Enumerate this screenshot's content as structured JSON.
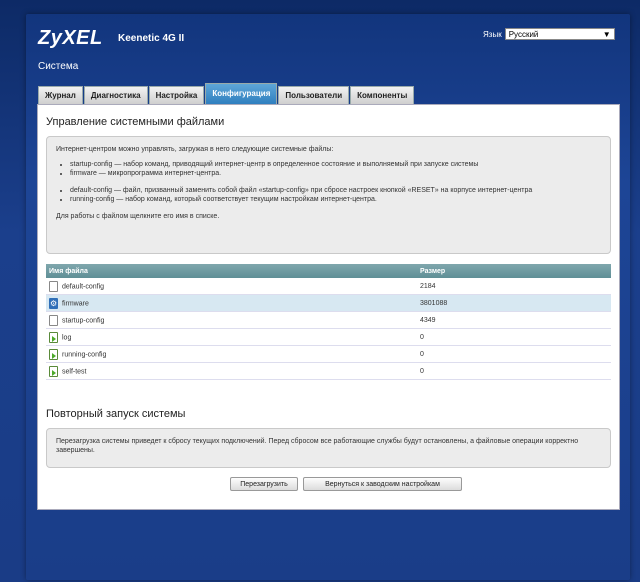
{
  "header": {
    "logo": "ZyXEL",
    "model": "Keenetic 4G II",
    "section": "Система",
    "language_label": "Язык",
    "language_value": "Русский"
  },
  "tabs": [
    {
      "label": "Журнал",
      "active": false
    },
    {
      "label": "Диагностика",
      "active": false
    },
    {
      "label": "Настройка",
      "active": false
    },
    {
      "label": "Конфигурация",
      "active": true
    },
    {
      "label": "Пользователи",
      "active": false
    },
    {
      "label": "Компоненты",
      "active": false
    }
  ],
  "files_section": {
    "title": "Управление системными файлами",
    "intro": "Интернет-центром можно управлять, загружая в него следующие системные файлы:",
    "bullets1": [
      "startup-config — набор команд, приводящий интернет-центр в определенное состояние и выполняемый при запуске системы",
      "firmware — микропрограмма интернет-центра."
    ],
    "bullets2": [
      "default-config — файл, призванный заменить собой файл «startup-config» при сбросе настроек кнопкой «RESET» на корпусе интернет-центра",
      "running-config — набор команд, который соответствует текущим настройкам интернет-центра."
    ],
    "hint": "Для работы с файлом щелкните его имя в списке.",
    "columns": [
      "Имя файла",
      "Размер"
    ],
    "rows": [
      {
        "name": "default-config",
        "size": "2184",
        "icon": "document-icon"
      },
      {
        "name": "firmware",
        "size": "3801088",
        "icon": "gear-icon"
      },
      {
        "name": "startup-config",
        "size": "4349",
        "icon": "document-icon"
      },
      {
        "name": "log",
        "size": "0",
        "icon": "document-run-icon"
      },
      {
        "name": "running-config",
        "size": "0",
        "icon": "document-run-icon"
      },
      {
        "name": "self-test",
        "size": "0",
        "icon": "document-run-icon"
      }
    ]
  },
  "restart_section": {
    "title": "Повторный запуск системы",
    "text": "Перезагрузка системы приведет к сбросу текущих подключений. Перед сбросом все работающие службы будут остановлены, а файловые операции корректно завершены.",
    "reboot_label": "Перезагрузить",
    "factory_label": "Вернуться к заводским настройкам"
  }
}
